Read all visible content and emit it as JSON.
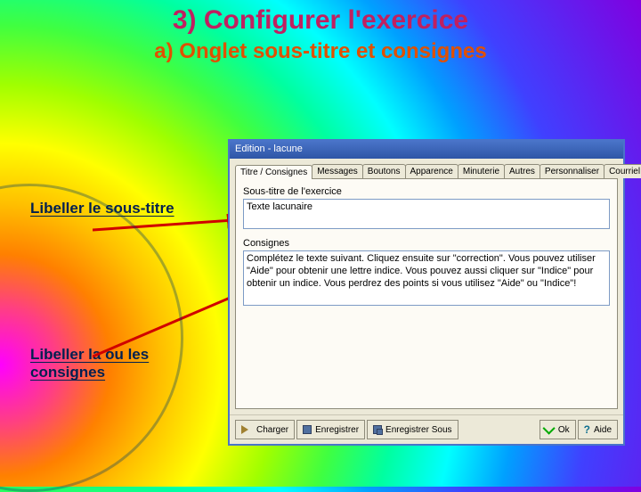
{
  "heading": "3) Configurer l'exercice",
  "subheading": "a) Onglet sous-titre et consignes",
  "annotations": {
    "a1": "Libeller le sous-titre",
    "a2": "Libeller la ou les consignes"
  },
  "dialog": {
    "title": "Edition - lacune",
    "tabs": [
      "Titre / Consignes",
      "Messages",
      "Boutons",
      "Apparence",
      "Minuterie",
      "Autres",
      "Personnaliser",
      "Courriel"
    ],
    "active_tab": 0,
    "subtitle_label": "Sous-titre de l'exercice",
    "subtitle_value": "Texte lacunaire",
    "consignes_label": "Consignes",
    "consignes_value": "Complétez le texte suivant. Cliquez ensuite sur \"correction\". Vous pouvez utiliser \"Aide\" pour obtenir une lettre indice. Vous pouvez aussi cliquer sur \"Indice\" pour obtenir un indice. Vous perdrez des points si vous utilisez \"Aide\" ou \"Indice\"!",
    "buttons": {
      "load": "Charger",
      "save": "Enregistrer",
      "saveas": "Enregistrer Sous",
      "ok": "Ok",
      "help": "Aide"
    }
  }
}
